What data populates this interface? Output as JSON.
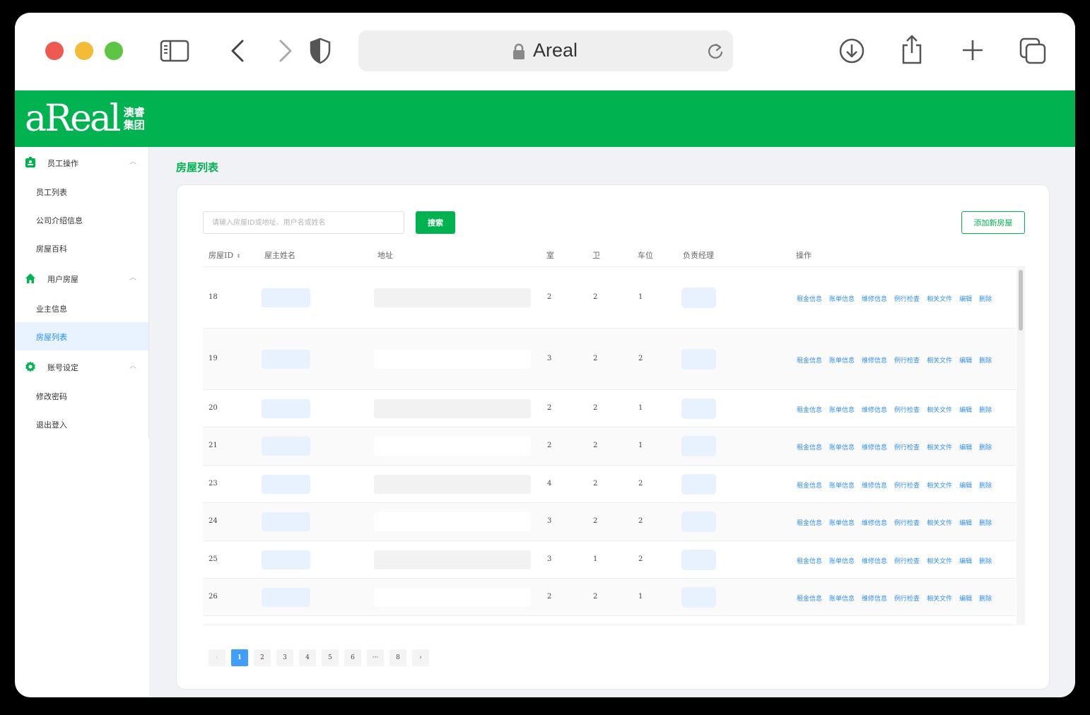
{
  "browser": {
    "url_text": "Areal"
  },
  "logo": {
    "word": "aReal",
    "cn_line1": "澳睿",
    "cn_line2": "集团"
  },
  "sidebar": {
    "groups": [
      {
        "label": "员工操作",
        "icon": "id-badge-icon",
        "items": [
          "员工列表",
          "公司介绍信息",
          "房屋百科"
        ]
      },
      {
        "label": "用户房屋",
        "icon": "home-icon",
        "items": [
          "业主信息",
          "房屋列表"
        ]
      },
      {
        "label": "账号设定",
        "icon": "gear-icon",
        "items": [
          "修改密码",
          "退出登入"
        ]
      }
    ],
    "active_item": "房屋列表"
  },
  "page": {
    "title": "房屋列表",
    "search_placeholder": "请输入房屋ID或地址、用户名或姓名",
    "search_button": "搜索",
    "add_button": "添加新房屋"
  },
  "table": {
    "headers": {
      "id": "房屋ID",
      "owner": "屋主姓名",
      "address": "地址",
      "rooms": "室",
      "baths": "卫",
      "parking": "车位",
      "manager": "负责经理",
      "ops": "操作"
    },
    "action_labels": [
      "租金信息",
      "账单信息",
      "维修信息",
      "例行检查",
      "相关文件",
      "编辑",
      "删除"
    ],
    "rows": [
      {
        "id": "18",
        "rooms": "2",
        "baths": "2",
        "parking": "1"
      },
      {
        "id": "19",
        "rooms": "3",
        "baths": "2",
        "parking": "2"
      },
      {
        "id": "20",
        "rooms": "2",
        "baths": "2",
        "parking": "1"
      },
      {
        "id": "21",
        "rooms": "2",
        "baths": "2",
        "parking": "1"
      },
      {
        "id": "23",
        "rooms": "4",
        "baths": "2",
        "parking": "2"
      },
      {
        "id": "24",
        "rooms": "3",
        "baths": "2",
        "parking": "2"
      },
      {
        "id": "25",
        "rooms": "3",
        "baths": "1",
        "parking": "2"
      },
      {
        "id": "26",
        "rooms": "2",
        "baths": "2",
        "parking": "1"
      }
    ]
  },
  "pagination": {
    "prev": "‹",
    "next": "›",
    "pages": [
      "1",
      "2",
      "3",
      "4",
      "5",
      "6",
      "···",
      "8"
    ],
    "current": "1"
  },
  "colors": {
    "brand_green": "#00b250",
    "link_blue": "#2f8ff0",
    "active_page": "#409eff"
  }
}
